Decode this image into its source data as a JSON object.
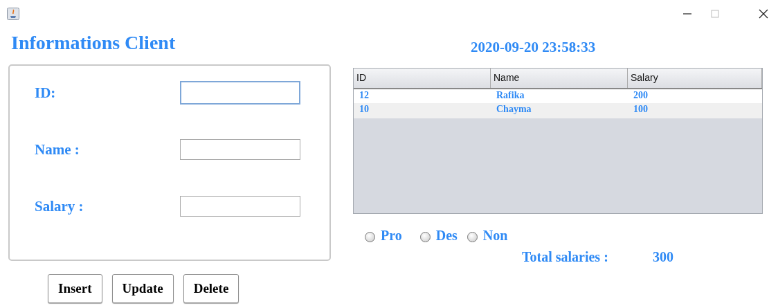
{
  "window": {
    "controls": [
      {
        "kind": "minimize"
      },
      {
        "kind": "maximize"
      },
      {
        "kind": "close"
      }
    ]
  },
  "heading": "Informations Client",
  "clock": "2020-09-20 23:58:33",
  "form": {
    "fields": [
      {
        "label": "ID:",
        "focused": true
      },
      {
        "label": "Name :",
        "focused": false
      },
      {
        "label": "Salary :",
        "focused": false
      }
    ]
  },
  "buttons": [
    "Insert",
    "Update",
    "Delete"
  ],
  "table": {
    "columns": [
      "ID",
      "Name",
      "Salary"
    ],
    "rows": [
      [
        "12",
        "Rafika",
        "200"
      ],
      [
        "10",
        "Chayma",
        "100"
      ]
    ]
  },
  "radios": [
    {
      "label": "Pro",
      "selected": false
    },
    {
      "label": "Des",
      "selected": false
    },
    {
      "label": "Non",
      "selected": false
    }
  ],
  "total": {
    "label": "Total salaries :",
    "value": "300"
  }
}
